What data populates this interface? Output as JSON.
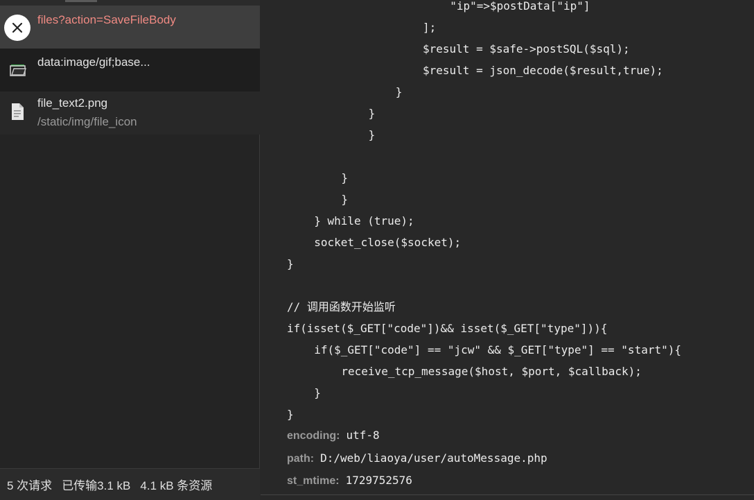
{
  "request_list": {
    "items": [
      {
        "name": "files?action=SaveFileBody",
        "icon": "close-icon",
        "selected": true
      },
      {
        "name": "data:image/gif;base...",
        "icon": "folder-icon"
      },
      {
        "name": "file_text2.png",
        "path": "/static/img/file_icon",
        "icon": "document-icon"
      }
    ]
  },
  "status_bar": {
    "requests": "5 次请求",
    "transferred": "已传输3.1 kB",
    "resources": "4.1 kB 条资源"
  },
  "response": {
    "code_lines": [
      "            \"ip\"=>$postData[\"ip\"]",
      "          ];",
      "          $result = $safe->postSQL($sql);",
      "          $result = json_decode($result,true);",
      "        }",
      "      }",
      "      }",
      "",
      "    }",
      "    }",
      "  } while (true);",
      "  socket_close($socket);",
      "}",
      "",
      "// 调用函数开始监听",
      "if(isset($_GET[\"code\"])&& isset($_GET[\"type\"])){",
      "  if($_GET[\"code\"] == \"jcw\" && $_GET[\"type\"] == \"start\"){",
      "    receive_tcp_message($host, $port, $callback);",
      "  }",
      "}"
    ],
    "meta": [
      {
        "key": "encoding:",
        "value": "utf-8"
      },
      {
        "key": "path:",
        "value": "D:/web/liaoya/user/autoMessage.php"
      },
      {
        "key": "st_mtime:",
        "value": "1729752576"
      }
    ]
  }
}
